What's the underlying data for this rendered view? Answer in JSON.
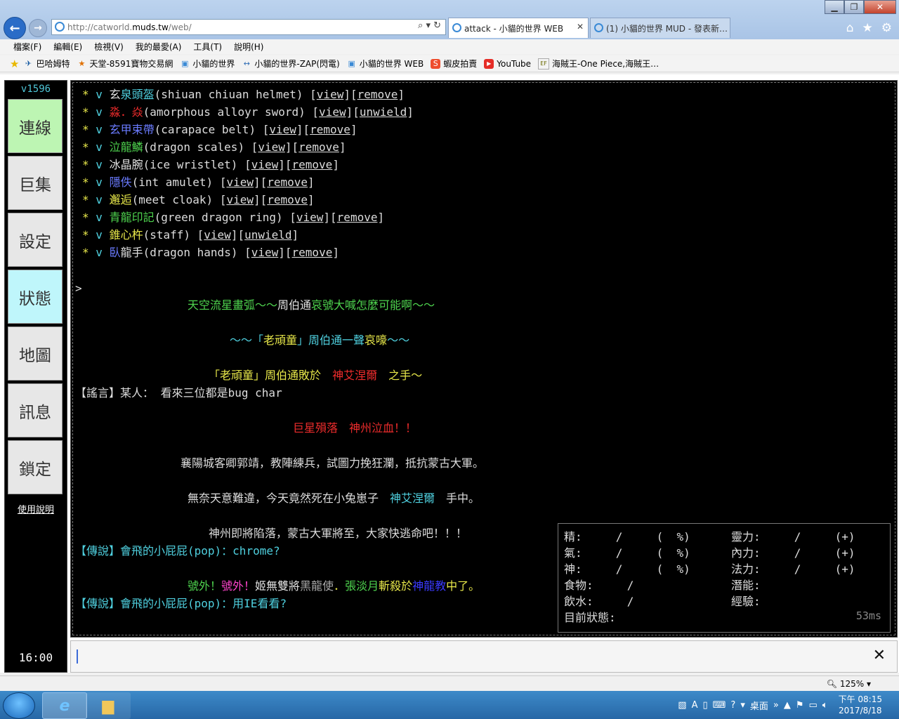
{
  "browser": {
    "url_prefix": "http://catworld.",
    "url_domain": "muds.tw",
    "url_suffix": "/web/",
    "addr_controls": "⌕ ▾ ↻",
    "tabs": [
      {
        "label": "attack - 小貓的世界 WEB",
        "close": "✕"
      },
      {
        "label": "(1) 小貓的世界 MUD - 發表新…"
      }
    ],
    "menu": [
      "檔案(F)",
      "編輯(E)",
      "檢視(V)",
      "我的最愛(A)",
      "工具(T)",
      "說明(H)"
    ],
    "favorites": [
      {
        "label": "巴哈姆特",
        "icon": "✈"
      },
      {
        "label": "天堂-8591寶物交易網",
        "icon": "★"
      },
      {
        "label": "小貓的世界",
        "icon": "▣"
      },
      {
        "label": "小貓的世界-ZAP(閃電)",
        "icon": "↔"
      },
      {
        "label": "小貓的世界 WEB",
        "icon": "▣"
      },
      {
        "label": "蝦皮拍賣",
        "icon": "S"
      },
      {
        "label": "YouTube",
        "icon": "▶"
      },
      {
        "label": "海賊王-One Piece,海賊王…",
        "icon": "EF"
      }
    ],
    "zoom": "125%"
  },
  "sidebar": {
    "version": "v1596",
    "buttons": [
      "連線",
      "巨集",
      "設定",
      "狀態",
      "地圖",
      "訊息",
      "鎖定"
    ],
    "help": "使用說明",
    "clock": "16:00"
  },
  "equipment": [
    {
      "name": "玄",
      "name2": "泉頭盔",
      "eng": "(shiuan chiuan helmet) ",
      "act": "remove"
    },
    {
      "name": "淼．焱",
      "name2": "",
      "eng": "(amorphous alloyr sword) ",
      "act": "unwield"
    },
    {
      "name": "玄甲束帶",
      "name2": "",
      "eng": "(carapace belt) ",
      "act": "remove"
    },
    {
      "name": "泣龍鱗",
      "name2": "",
      "eng": "(dragon scales) ",
      "act": "remove"
    },
    {
      "name": "冰晶腕",
      "name2": "",
      "eng": "(ice wristlet) ",
      "act": "remove"
    },
    {
      "name": "隱佚",
      "name2": "",
      "eng": "(int amulet) ",
      "act": "remove"
    },
    {
      "name": "邂逅",
      "name2": "",
      "eng": "(meet cloak) ",
      "act": "remove"
    },
    {
      "name": "青龍印記",
      "name2": "",
      "eng": "(green dragon ring) ",
      "act": "remove"
    },
    {
      "name": "錐心杵",
      "name2": "",
      "eng": "(staff) ",
      "act": "unwield"
    },
    {
      "name": "臥",
      "name2": "龍手",
      "eng": "(dragon hands) ",
      "act": "remove"
    }
  ],
  "equip_marks": {
    "star": "*",
    "v": "v",
    "view": "view"
  },
  "messages": {
    "prompt": ">",
    "m1a": "天空流星畫弧～～",
    "m1b": "周伯通",
    "m1c": "哀號大喊怎麼可能啊～～",
    "m2a": "～～「",
    "m2b": "老頑童",
    "m2c": "」周伯通一聲",
    "m2d": "哀嚎",
    "m2e": "～～",
    "m3a": "「",
    "m3b": "老頑童",
    "m3c": "」周伯通",
    "m3d": "敗於　",
    "m3e": "神艾涅爾",
    "m3f": "　之手～",
    "rumor": "【謠言】某人： 看來三位都是bug char",
    "m4a": "巨星殞落　",
    "m4b": "神州泣血！！",
    "m5": "襄陽城客卿郭靖，教陣練兵，試圖力挽狂瀾，抵抗蒙古大軍。",
    "m6a": "無奈天意難違，今天竟然死在小兔崽子　",
    "m6b": "神艾涅爾",
    "m6c": "　手中。",
    "m7": "神州即將陷落，蒙古大軍將至，大家快逃命吧！！！",
    "legend1a": "【傳說】會飛的小屁屁(pop)：",
    "legend1b": "chrome?",
    "m8a": "號外！",
    "m8b": "號外！",
    "m8c": "姬無雙將",
    "m8d": "黑龍使",
    "m8e": "．",
    "m8f": "張淡月",
    "m8g": "斬殺於",
    "m8h": "神龍教",
    "m8i": "中了。",
    "legend2a": "【傳說】會飛的小屁屁(pop)：",
    "legend2b": "用IE看看?"
  },
  "status": {
    "r1a": "精:     /     (  %)",
    "r1b": "靈力:     /     (+)",
    "r2a": "氣:     /     (  %)",
    "r2b": "內力:     /     (+)",
    "r3a": "神:     /     (  %)",
    "r3b": "法力:     /     (+)",
    "r4a": "食物:     /",
    "r4b": "潛能:",
    "r5a": "飲水:     /",
    "r5b": "經驗:",
    "r6a": "目前狀態:",
    "ping": "53ms"
  },
  "input": {
    "clear": "✕"
  },
  "taskbar": {
    "desktop": "桌面",
    "time": "下午 08:15",
    "date": "2017/8/18"
  }
}
